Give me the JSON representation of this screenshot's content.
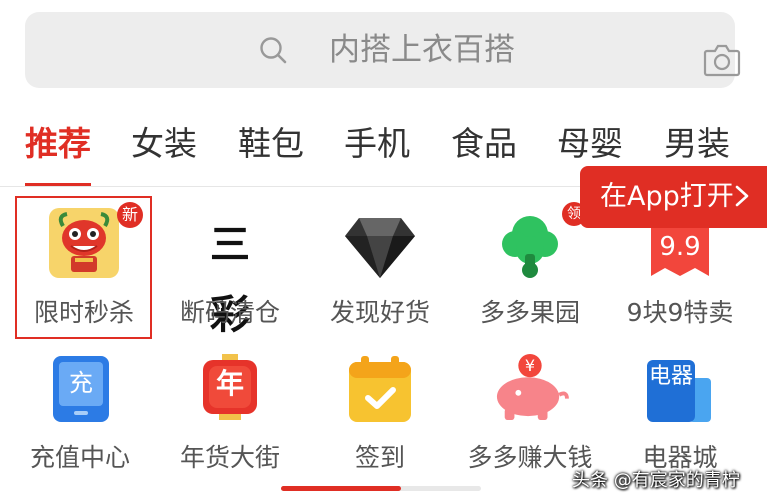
{
  "search": {
    "placeholder": "内搭上衣百搭",
    "icons": {
      "left": "search-icon",
      "right": "camera-icon"
    }
  },
  "tabs": [
    {
      "label": "推荐",
      "active": true
    },
    {
      "label": "女装"
    },
    {
      "label": "鞋包"
    },
    {
      "label": "手机"
    },
    {
      "label": "食品"
    },
    {
      "label": "母婴"
    },
    {
      "label": "男装"
    }
  ],
  "open_app": {
    "label": "在App打开"
  },
  "grid": [
    {
      "label": "限时秒杀",
      "icon": "lion-dance-icon",
      "badge": "新"
    },
    {
      "label": "断码清仓",
      "icon": "sancai-logo",
      "icon_text": "三彩"
    },
    {
      "label": "发现好货",
      "icon": "diamond-icon"
    },
    {
      "label": "多多果园",
      "icon": "tree-icon",
      "badge": "领"
    },
    {
      "label": "9块9特卖",
      "icon": "price-tag-icon",
      "icon_text": "9.9"
    },
    {
      "label": "充值中心",
      "icon": "phone-recharge-icon",
      "icon_text": "充"
    },
    {
      "label": "年货大街",
      "icon": "lantern-icon",
      "icon_text": "年"
    },
    {
      "label": "签到",
      "icon": "calendar-check-icon"
    },
    {
      "label": "多多赚大钱",
      "icon": "piggy-bank-icon",
      "icon_text": "¥"
    },
    {
      "label": "电器城",
      "icon": "appliance-icon",
      "icon_text": "电器"
    }
  ],
  "watermark": "头条 @有宸家的青柠",
  "colors": {
    "accent": "#e02e24",
    "search_bg": "#ededed"
  }
}
